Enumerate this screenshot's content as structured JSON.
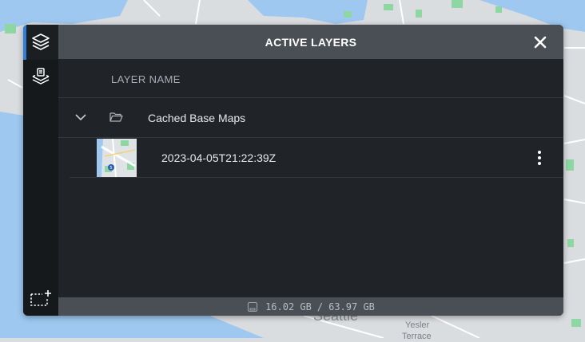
{
  "map": {
    "city_label": "Seattle",
    "neighborhood_label_1": "Yesler",
    "neighborhood_label_2": "Terrace",
    "colors": {
      "water": "#9ec8f0",
      "land": "#dadde0",
      "park": "#8ed7a3",
      "road": "#ffffff"
    }
  },
  "rail": {
    "items": [
      {
        "name": "layers",
        "icon": "layers-icon",
        "active": true
      },
      {
        "name": "offline-layers",
        "icon": "offline-layers-icon",
        "active": false
      }
    ],
    "bottom_item": {
      "name": "select-area",
      "icon": "select-area-add-icon"
    }
  },
  "header": {
    "title": "ACTIVE LAYERS",
    "close_icon": "close-icon"
  },
  "table": {
    "column_header": "LAYER NAME"
  },
  "group": {
    "label": "Cached Base Maps",
    "expanded": true,
    "icon": "folder-open-icon"
  },
  "layer": {
    "label": "2023-04-05T21:22:39Z",
    "thumbnail": "map-thumbnail",
    "thumbnail_badge": "5",
    "menu_icon": "more-vertical-icon"
  },
  "footer": {
    "used": "16.02 GB",
    "separator": "/",
    "total": "63.97 GB",
    "icon": "storage-card-icon"
  },
  "colors": {
    "accent": "#2f7fd6",
    "header_bg": "#4a4f55",
    "panel_bg": "#202428",
    "rail_bg": "#16191c"
  }
}
